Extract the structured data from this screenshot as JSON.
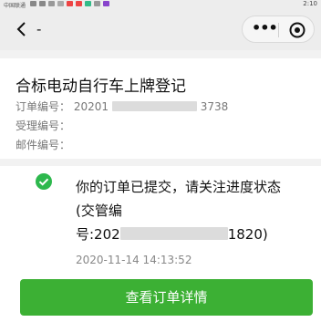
{
  "status_bar": {
    "carrier": "中国联通",
    "time": "2:10"
  },
  "navbar": {
    "back_icon": "chevron-left-icon",
    "title": "-",
    "more_icon": "more-dots-icon",
    "close_icon": "target-circle-icon"
  },
  "order": {
    "title": "合标电动自行车上牌登记",
    "order_no_label": "订单编号：",
    "order_no_prefix": "20201",
    "order_no_suffix": "3738",
    "accept_no_label": "受理编号：",
    "mail_no_label": "邮件编号："
  },
  "result": {
    "icon": "check-circle-icon",
    "line1": "你的订单已提交，请关注进度状态",
    "line2": "(交管编",
    "line3_prefix": "号:202",
    "line3_suffix": "1820)",
    "timestamp": "2020-11-14 14:13:52",
    "button_label": "查看订单详情"
  },
  "colors": {
    "accent_green": "#3cb034",
    "check_green": "#2db84d"
  }
}
